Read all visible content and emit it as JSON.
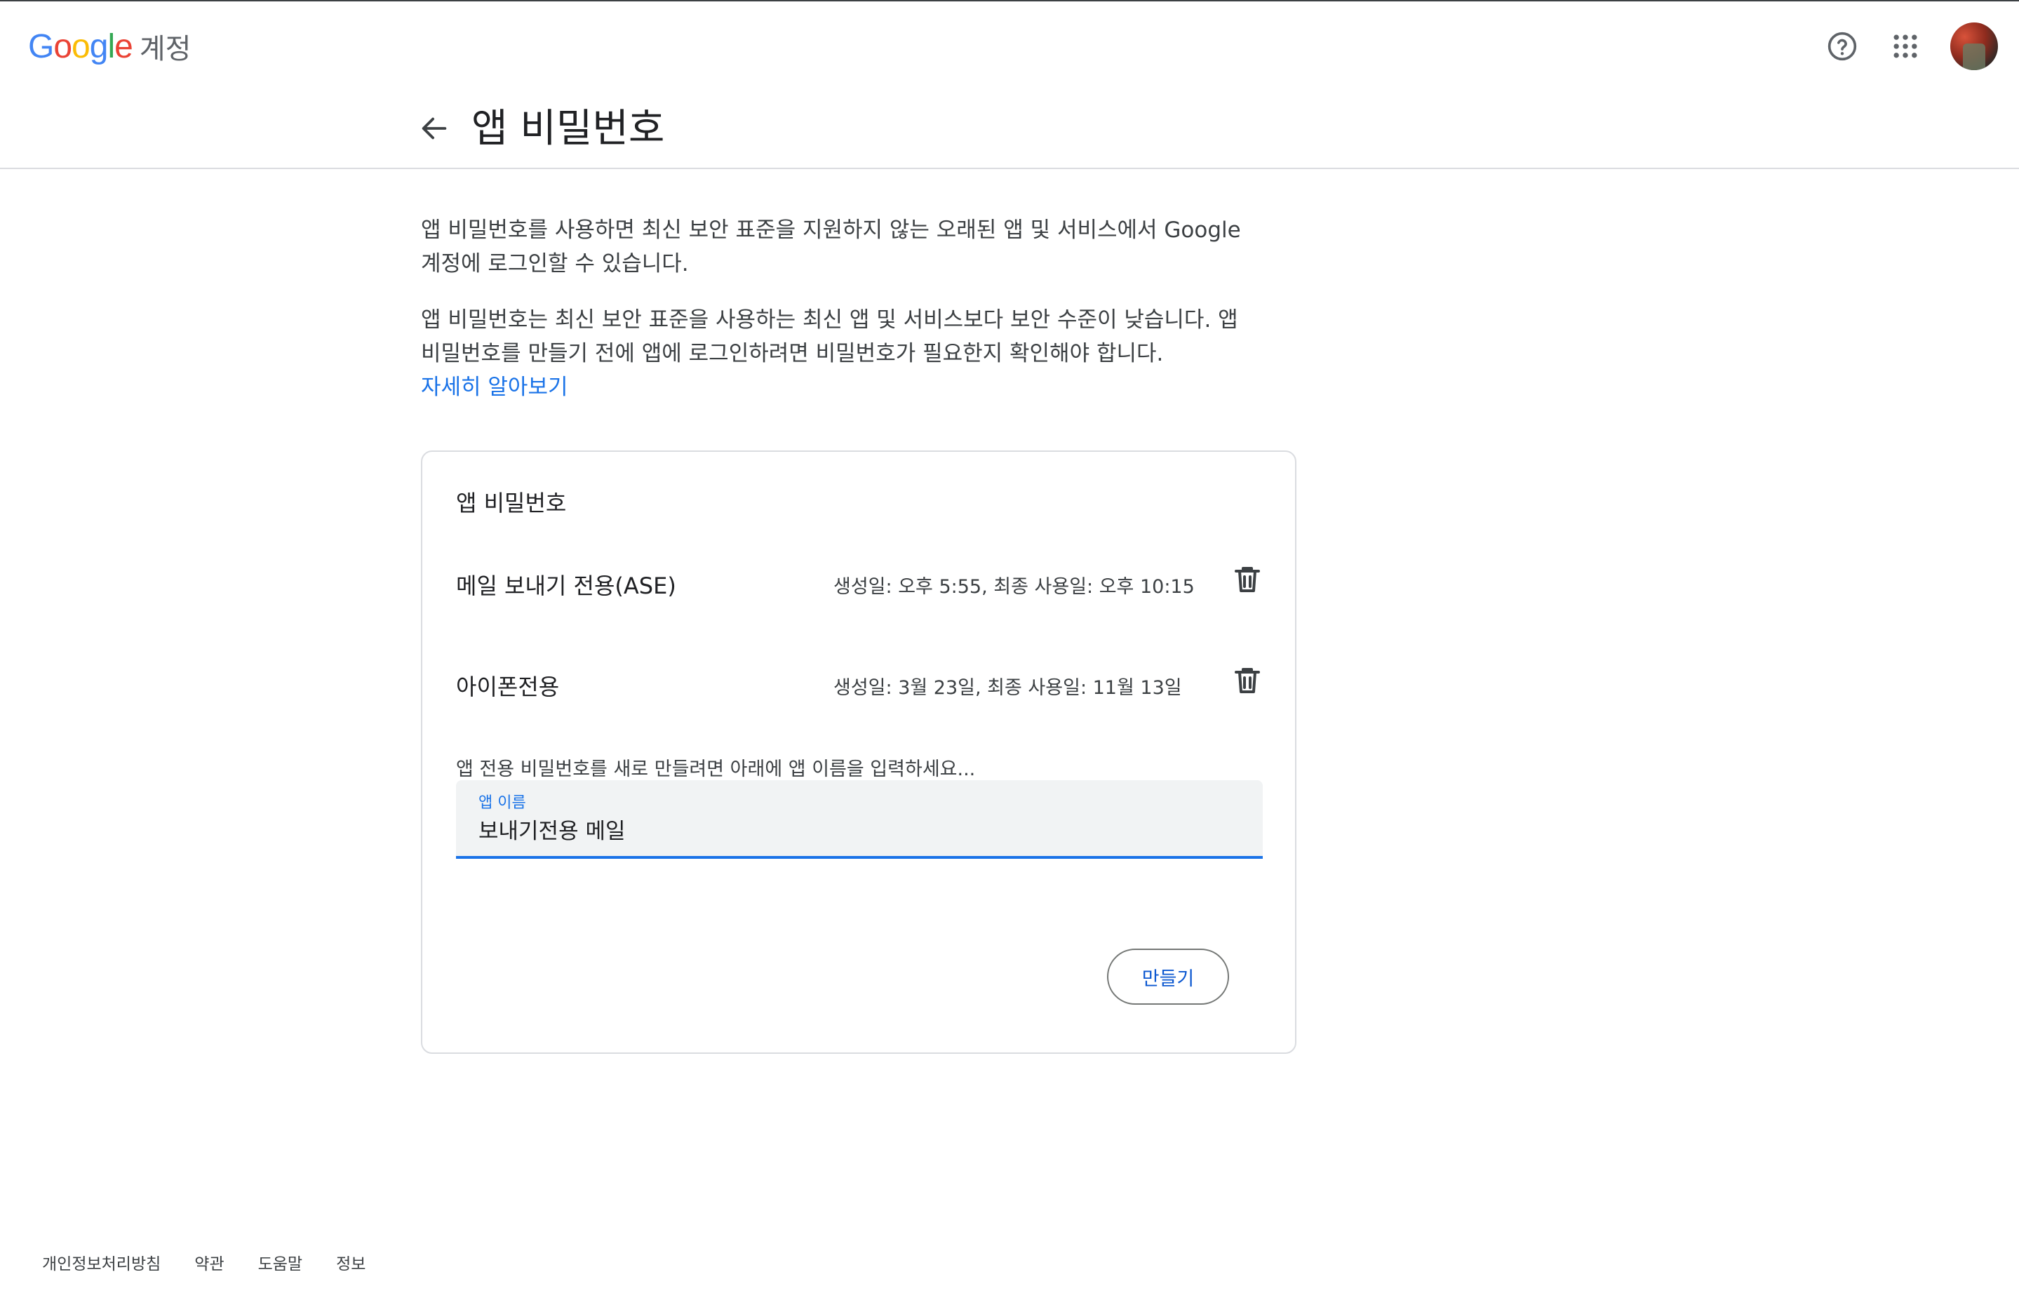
{
  "header": {
    "logo_text": "Google",
    "product_name": "계정",
    "help_icon": "help-circle-icon",
    "apps_icon": "apps-grid-icon"
  },
  "page": {
    "back_icon": "arrow-left-icon",
    "title": "앱 비밀번호"
  },
  "intro": {
    "paragraph1": "앱 비밀번호를 사용하면 최신 보안 표준을 지원하지 않는 오래된 앱 및 서비스에서 Google 계정에 로그인할 수 있습니다.",
    "paragraph2": "앱 비밀번호는 최신 보안 표준을 사용하는 최신 앱 및 서비스보다 보안 수준이 낮습니다. 앱 비밀번호를 만들기 전에 앱에 로그인하려면 비밀번호가 필요한지 확인해야 합니다.",
    "learn_more": "자세히 알아보기"
  },
  "card": {
    "title": "앱 비밀번호",
    "passwords": [
      {
        "name": "메일 보내기 전용(ASE)",
        "meta": "생성일: 오후 5:55, 최종 사용일: 오후 10:15"
      },
      {
        "name": "아이폰전용",
        "meta": "생성일: 3월 23일, 최종 사용일: 11월 13일"
      }
    ],
    "hint": "앱 전용 비밀번호를 새로 만들려면 아래에 앱 이름을 입력하세요...",
    "field_label": "앱 이름",
    "field_value": "보내기전용 메일",
    "create_label": "만들기"
  },
  "footer": {
    "links": [
      "개인정보처리방침",
      "약관",
      "도움말",
      "정보"
    ]
  },
  "colors": {
    "accent": "#1a73e8",
    "button_text": "#0b57d0",
    "border": "#dadce0"
  }
}
